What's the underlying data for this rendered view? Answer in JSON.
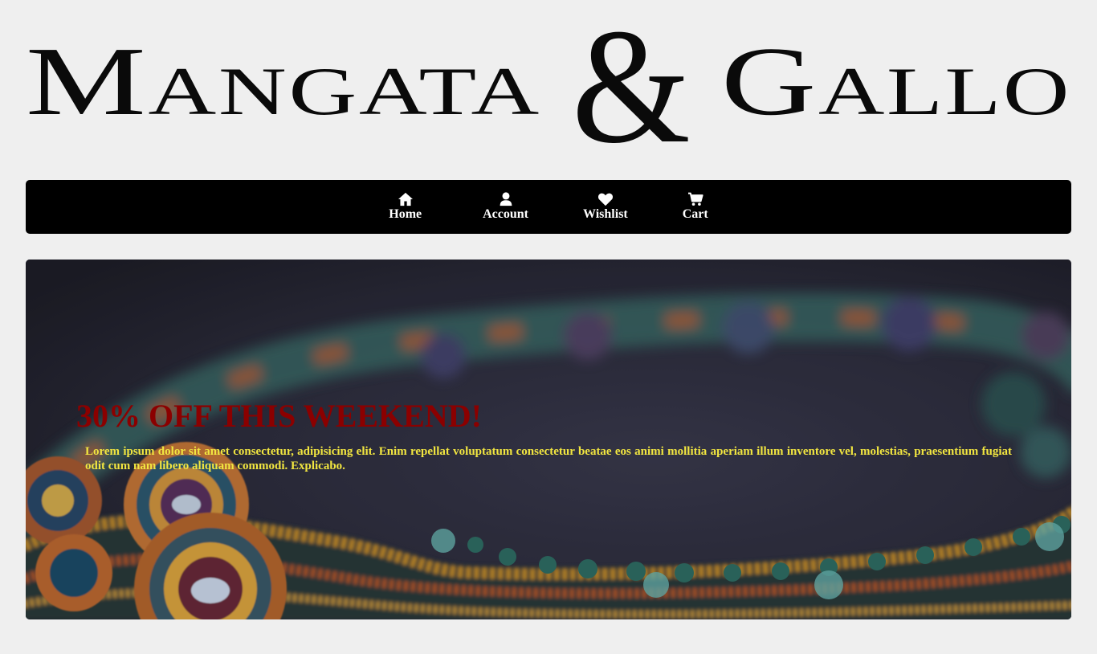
{
  "brand": {
    "logo_text_left": "Mangata",
    "logo_ampersand": "&",
    "logo_text_right": "Gallo"
  },
  "nav": {
    "items": [
      {
        "label": "Home",
        "icon": "home-icon"
      },
      {
        "label": "Account",
        "icon": "user-icon"
      },
      {
        "label": "Wishlist",
        "icon": "heart-icon"
      },
      {
        "label": "Cart",
        "icon": "cart-icon"
      }
    ]
  },
  "hero": {
    "heading": "30% OFF THIS WEEKEND!",
    "body": "Lorem ipsum dolor sit amet consectetur, adipisicing elit. Enim repellat voluptatum consectetur beatae eos animi mollitia aperiam illum inventore vel, molestias, praesentium fugiat odit cum nam libero aliquam commodi. Explicabo."
  },
  "colors": {
    "page_background": "#efefef",
    "nav_background": "#000000",
    "nav_text": "#ffffff",
    "heading": "#8b0000",
    "body_text": "#f2e640"
  }
}
